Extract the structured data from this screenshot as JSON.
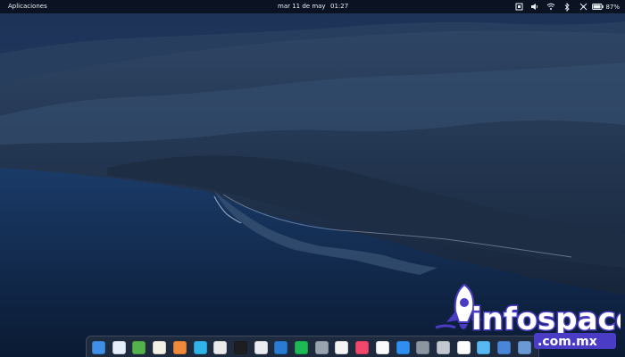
{
  "topbar": {
    "applications_label": "Aplicaciones",
    "date": "mar 11 de may",
    "time": "01:27",
    "battery_percent": "87%"
  },
  "tray_icons": [
    "square-tray-icon",
    "speaker-icon",
    "wifi-icon",
    "bluetooth-icon",
    "network-icon",
    "battery-icon"
  ],
  "dock": {
    "apps": [
      {
        "name": "files-app",
        "color": "#3f8fe6"
      },
      {
        "name": "document-app",
        "color": "#e6eefb"
      },
      {
        "name": "spreadsheet-app",
        "color": "#54b24d"
      },
      {
        "name": "text-editor-app",
        "color": "#f3f0e6"
      },
      {
        "name": "presentation-app",
        "color": "#f08a3a"
      },
      {
        "name": "video-app",
        "color": "#2fb3e8"
      },
      {
        "name": "chrome-app",
        "color": "#eaeaea"
      },
      {
        "name": "terminal-app",
        "color": "#1e1e22"
      },
      {
        "name": "pen-app",
        "color": "#e9ecf0"
      },
      {
        "name": "vscode-app",
        "color": "#2a7cd3"
      },
      {
        "name": "spotify-app",
        "color": "#1db954"
      },
      {
        "name": "disk-app",
        "color": "#9aa4b0"
      },
      {
        "name": "calendar-app",
        "color": "#f4f4f4"
      },
      {
        "name": "music-app",
        "color": "#f0476a"
      },
      {
        "name": "photos-app",
        "color": "#fbfbfb"
      },
      {
        "name": "app-store-app",
        "color": "#2e8ff0"
      },
      {
        "name": "system-settings-app",
        "color": "#8c96a2"
      },
      {
        "name": "gear-app",
        "color": "#c2c8cf"
      },
      {
        "name": "arch-app",
        "color": "#ffffff"
      },
      {
        "name": "folder-app",
        "color": "#58b9f2"
      },
      {
        "name": "window-app",
        "color": "#4a86d8"
      },
      {
        "name": "display-app",
        "color": "#6a9ad6"
      }
    ]
  },
  "watermark": {
    "brand": "infospace",
    "domain": ".com.mx"
  },
  "colors": {
    "sky": "#233b63",
    "ocean": "#15325a",
    "brand": "#4a3cc4"
  }
}
